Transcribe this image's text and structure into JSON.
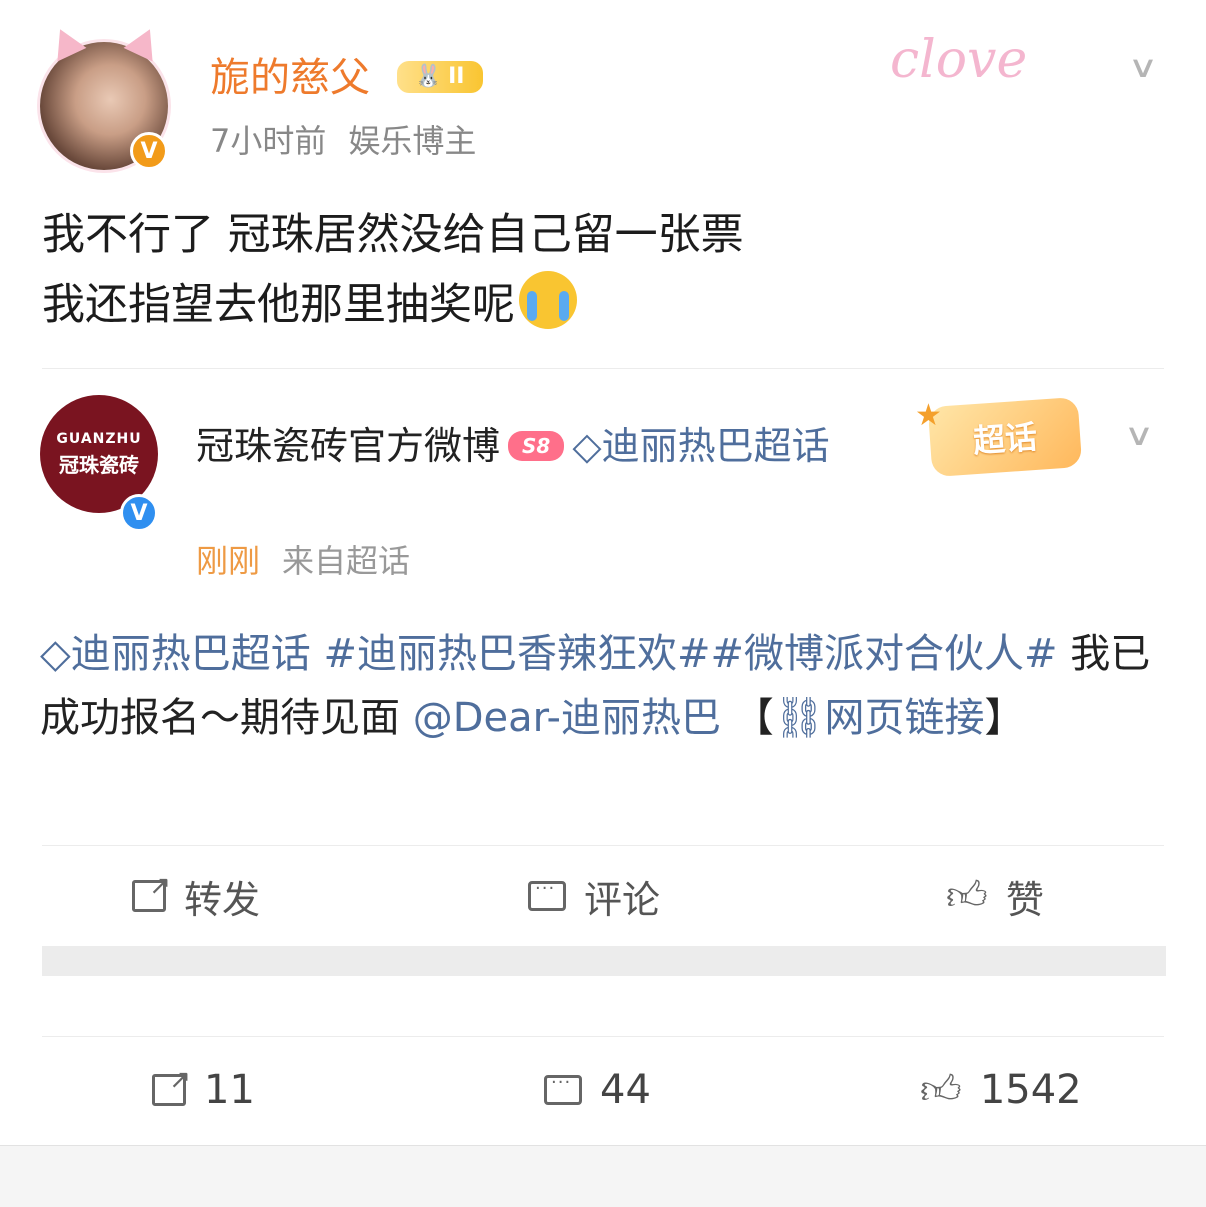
{
  "post": {
    "author": "旎的慈父",
    "level_badge": "II",
    "time": "7小时前",
    "identity": "娱乐博主",
    "decoration": "clove",
    "text_line1": "我不行了 冠珠居然没给自己留一张票",
    "text_line2": "我还指望去他那里抽奖呢",
    "emoji": "crying-face"
  },
  "retweet": {
    "avatar_line1": "GUANZHU",
    "avatar_line2": "冠珠瓷砖",
    "author": "冠珠瓷砖官方微博",
    "level": "S8",
    "topic_prefix": "◇",
    "topic": "迪丽热巴超话",
    "time": "刚刚",
    "source": "来自超话",
    "chaohua_label": "超话",
    "body_topic": "◇迪丽热巴超话",
    "body_tag1": "#迪丽热巴香辣狂欢#",
    "body_tag2": "#微博派对合伙人#",
    "body_plain": "我已成功报名～期待见面",
    "body_mention": "@Dear-迪丽热巴",
    "body_link_open": "【",
    "body_link": "⛓网页链接",
    "body_link_close": "】",
    "actions": {
      "repost": "转发",
      "comment": "评论",
      "like": "赞"
    }
  },
  "stats": {
    "reposts": "11",
    "comments": "44",
    "likes": "1542"
  },
  "colors": {
    "author_orange": "#ee7a2c",
    "link_blue": "#4f6e9c",
    "verify_orange": "#f29b19",
    "verify_blue": "#2f8ff0"
  }
}
